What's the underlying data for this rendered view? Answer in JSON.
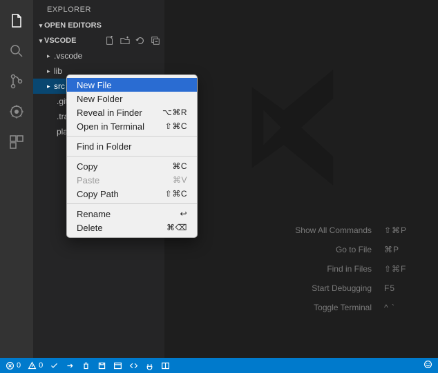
{
  "sidebar": {
    "title": "EXPLORER",
    "sections": {
      "openEditors": "OPEN EDITORS",
      "root": "VSCODE"
    },
    "tree": [
      {
        "label": ".vscode",
        "type": "folder"
      },
      {
        "label": "lib",
        "type": "folder"
      },
      {
        "label": "src",
        "type": "folder",
        "selected": true
      },
      {
        "label": ".gitig",
        "type": "file"
      },
      {
        "label": ".travi",
        "type": "file"
      },
      {
        "label": "platf",
        "type": "file"
      }
    ]
  },
  "contextMenu": [
    {
      "label": "New File",
      "shortcut": "",
      "highlight": true
    },
    {
      "label": "New Folder",
      "shortcut": ""
    },
    {
      "label": "Reveal in Finder",
      "shortcut": "⌥⌘R"
    },
    {
      "label": "Open in Terminal",
      "shortcut": "⇧⌘C"
    },
    {
      "sep": true
    },
    {
      "label": "Find in Folder",
      "shortcut": ""
    },
    {
      "sep": true
    },
    {
      "label": "Copy",
      "shortcut": "⌘C"
    },
    {
      "label": "Paste",
      "shortcut": "⌘V",
      "disabled": true
    },
    {
      "label": "Copy Path",
      "shortcut": "⇧⌘C"
    },
    {
      "sep": true
    },
    {
      "label": "Rename",
      "shortcut": "↩"
    },
    {
      "label": "Delete",
      "shortcut": "⌘⌫"
    }
  ],
  "shortcuts": [
    {
      "label": "Show All Commands",
      "key": "⇧⌘P"
    },
    {
      "label": "Go to File",
      "key": "⌘P"
    },
    {
      "label": "Find in Files",
      "key": "⇧⌘F"
    },
    {
      "label": "Start Debugging",
      "key": "F5"
    },
    {
      "label": "Toggle Terminal",
      "key": "^ `"
    }
  ],
  "status": {
    "errors": "0",
    "warnings": "0"
  }
}
